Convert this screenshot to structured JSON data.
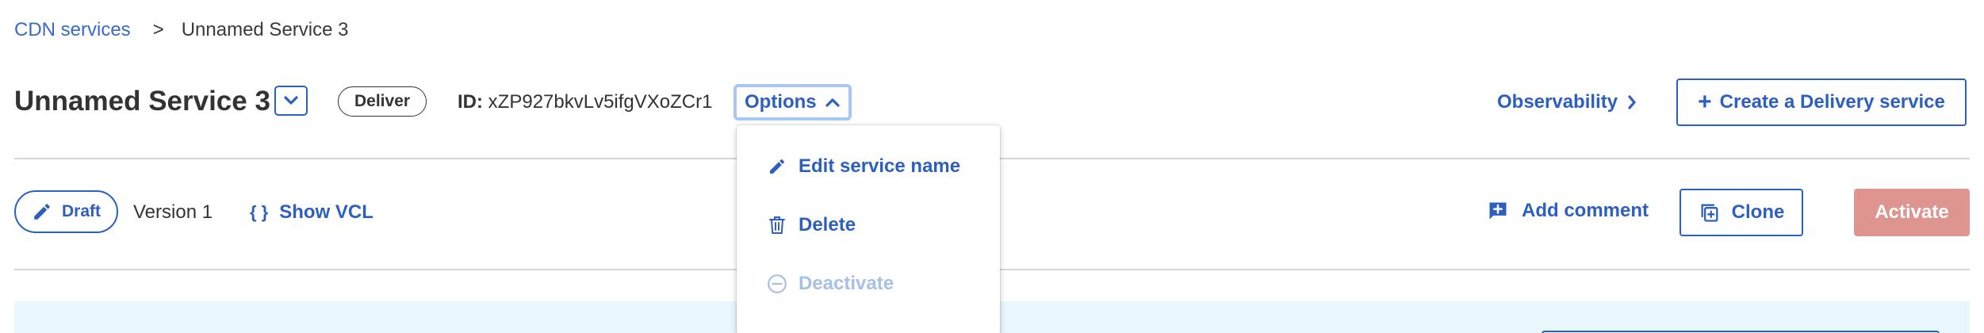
{
  "breadcrumb": {
    "parent": "CDN services",
    "separator": ">",
    "current": "Unnamed Service 3"
  },
  "header": {
    "title": "Unnamed Service 3",
    "badge": "Deliver",
    "id_label": "ID:",
    "id_value": "xZP927bkvLv5ifgVXoZCr1",
    "options_label": "Options",
    "observability_label": "Observability",
    "create_label": "Create a Delivery service"
  },
  "version_bar": {
    "draft_label": "Draft",
    "version_label": "Version 1",
    "show_vcl_label": "Show VCL",
    "add_comment_label": "Add comment",
    "clone_label": "Clone",
    "activate_label": "Activate"
  },
  "options_menu": {
    "items": [
      {
        "label": "Edit service name",
        "icon": "pencil-icon",
        "disabled": false
      },
      {
        "label": "Delete",
        "icon": "trash-icon",
        "disabled": false
      },
      {
        "label": "Deactivate",
        "icon": "minus-circle-icon",
        "disabled": true
      }
    ]
  },
  "colors": {
    "accent": "#2d5fc0",
    "link": "#3a6ac9",
    "activate_disabled": "#de9590",
    "banner_bg": "#e9f6fb",
    "focus_ring": "#a9c7f3"
  }
}
